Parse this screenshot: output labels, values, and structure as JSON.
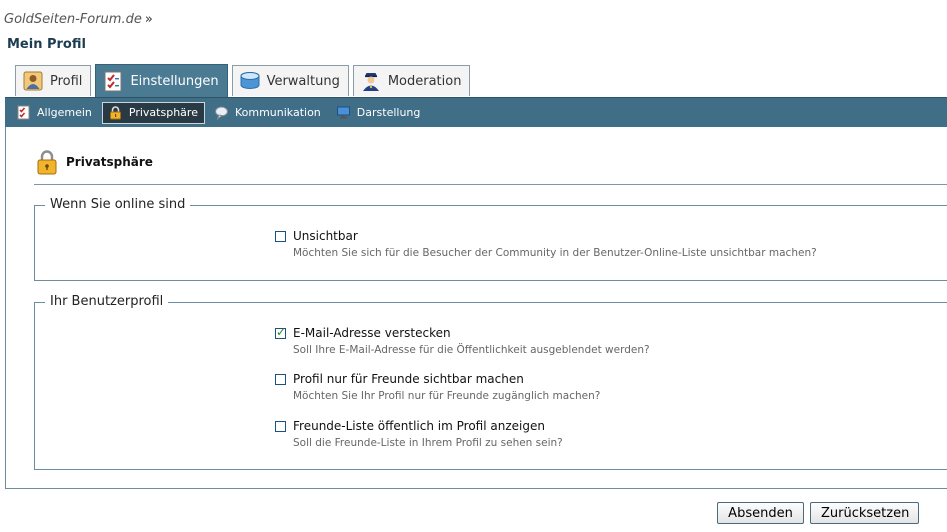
{
  "breadcrumb": {
    "site": "GoldSeiten-Forum.de",
    "separator": "»"
  },
  "page_title": "Mein Profil",
  "tabs": [
    {
      "label": "Profil",
      "icon": "profile-icon",
      "active": false
    },
    {
      "label": "Einstellungen",
      "icon": "checklist-icon",
      "active": true
    },
    {
      "label": "Verwaltung",
      "icon": "database-icon",
      "active": false
    },
    {
      "label": "Moderation",
      "icon": "moderator-icon",
      "active": false
    }
  ],
  "subnav": [
    {
      "label": "Allgemein",
      "icon": "checklist-icon",
      "active": false
    },
    {
      "label": "Privatsphäre",
      "icon": "lock-icon",
      "active": true
    },
    {
      "label": "Kommunikation",
      "icon": "speech-bubble-icon",
      "active": false
    },
    {
      "label": "Darstellung",
      "icon": "monitor-icon",
      "active": false
    }
  ],
  "section": {
    "title": "Privatsphäre",
    "icon": "lock-icon"
  },
  "fieldsets": [
    {
      "legend": "Wenn Sie online sind",
      "options": [
        {
          "label": "Unsichtbar",
          "description": "Möchten Sie sich für die Besucher der Community in der Benutzer-Online-Liste unsichtbar machen?",
          "checked": false
        }
      ]
    },
    {
      "legend": "Ihr Benutzerprofil",
      "options": [
        {
          "label": "E-Mail-Adresse verstecken",
          "description": "Soll Ihre E-Mail-Adresse für die Öffentlichkeit ausgeblendet werden?",
          "checked": true
        },
        {
          "label": "Profil nur für Freunde sichtbar machen",
          "description": "Möchten Sie Ihr Profil nur für Freunde zugänglich machen?",
          "checked": false
        },
        {
          "label": "Freunde-Liste öffentlich im Profil anzeigen",
          "description": "Soll die Freunde-Liste in Ihrem Profil zu sehen sein?",
          "checked": false
        }
      ]
    }
  ],
  "buttons": {
    "submit": "Absenden",
    "reset": "Zurücksetzen"
  },
  "colors": {
    "accent": "#3f6e86",
    "active_tab": "#4a7b93",
    "border": "#6b8d9f"
  }
}
